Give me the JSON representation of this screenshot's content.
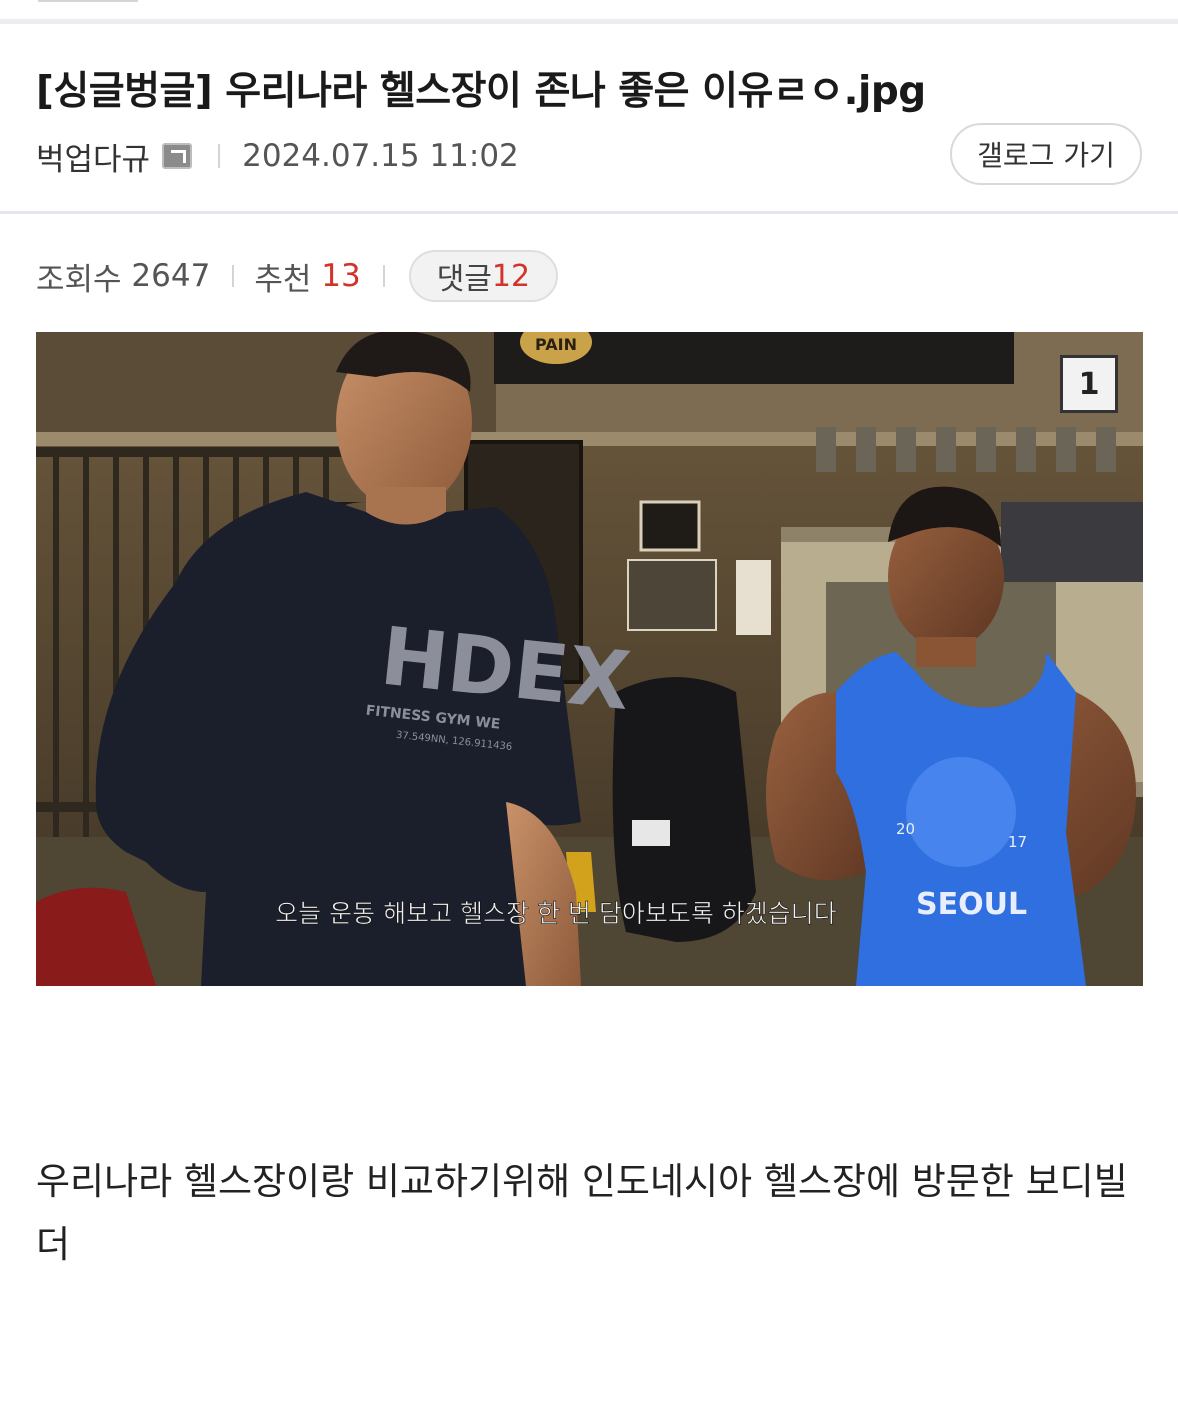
{
  "post": {
    "title": "[싱글벙글] 우리나라 헬스장이 존나 좋은 이유ㄹㅇ.jpg",
    "author": "벅업다규",
    "author_badge_icon": "level-badge-icon",
    "date": "2024.07.15 11:02",
    "gallery_button": "갤로그 가기",
    "views_label": "조회수",
    "views": "2647",
    "recommend_label": "추천",
    "recommend": "13",
    "comments_label": "댓글",
    "comments": "12",
    "image_index": "1",
    "image_subtitle": "오늘 운동 해보고 헬스장 한 번 담아보도록 하겠습니다",
    "image_sign": "PAIN",
    "shirt_brand": "HDEX",
    "shirt_subtext": "FITNESS GYM WE",
    "shirt_coords": "37.549NN, 126.911436",
    "tank_text": "SEOUL",
    "tank_year_left": "20",
    "tank_year_right": "17",
    "body": "우리나라 헬스장이랑 비교하기위해 인도네시아 헬스장에 방문한 보디빌더"
  },
  "colors": {
    "accent_red": "#d2342c",
    "divider": "#e6e6ee"
  }
}
